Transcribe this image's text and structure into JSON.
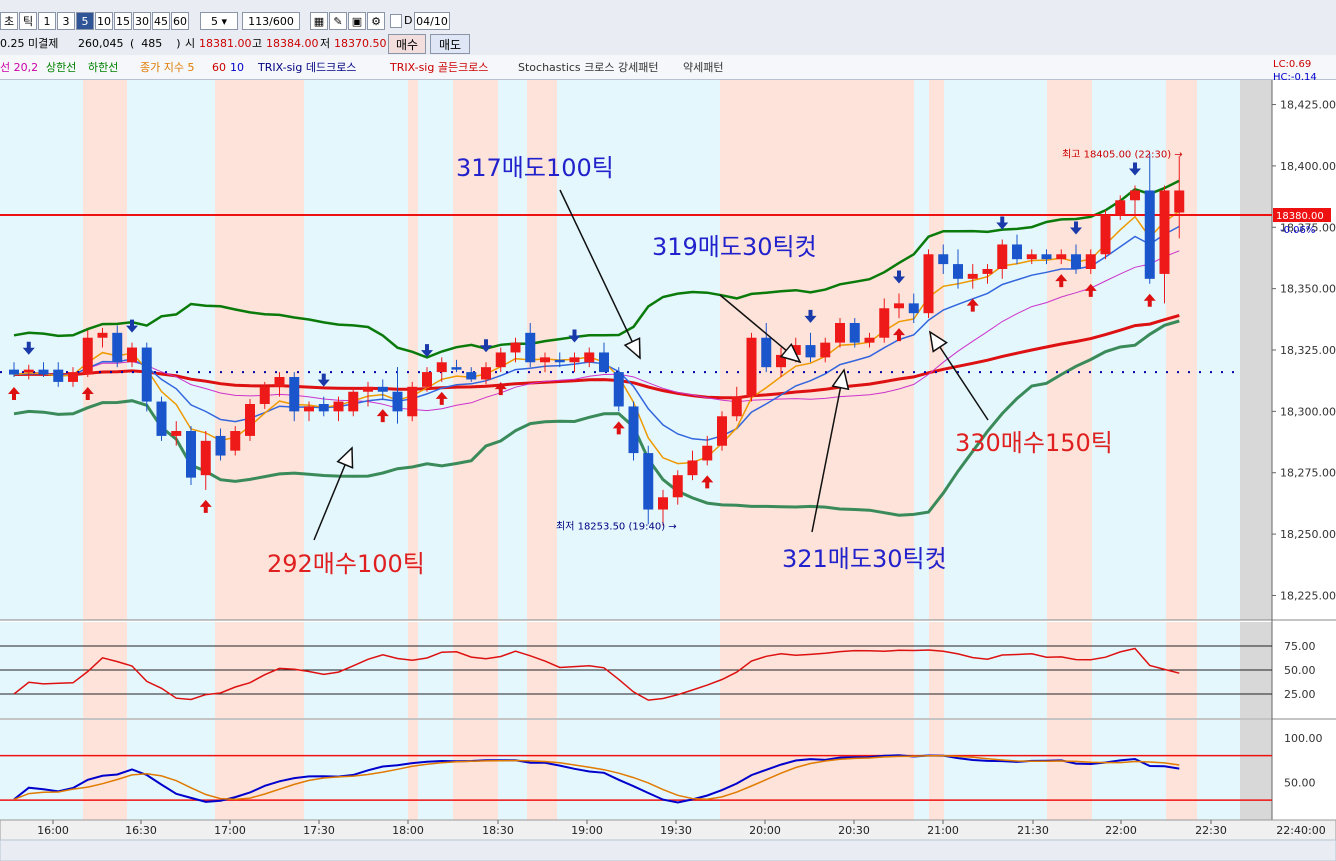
{
  "toolbar": {
    "period_buttons": [
      "초",
      "틱",
      "1",
      "3",
      "5",
      "10",
      "15",
      "30",
      "45",
      "60"
    ],
    "selected_period": "5",
    "period_value": "5",
    "count": "113/600",
    "date": "04/10"
  },
  "quote": {
    "prefix": "0.25",
    "open_interest_label": "미결제",
    "open_interest": "260,045",
    "oi_change": "485",
    "open_label": "시",
    "open": "18381.00",
    "high_label": "고",
    "high": "18384.00",
    "low_label": "저",
    "low": "18370.50",
    "buy_button": "매수",
    "sell_button": "매도"
  },
  "legend": {
    "items": [
      {
        "text": "선 20,2",
        "color": "#cc00aa"
      },
      {
        "text": "상한선",
        "color": "#008000"
      },
      {
        "text": "하한선",
        "color": "#008000"
      },
      {
        "text": "종가 지수 5",
        "color": "#e07b00"
      },
      {
        "text": "60",
        "color": "#cc0000"
      },
      {
        "text": "10",
        "color": "#0000cc"
      },
      {
        "text": "TRIX-sig 데드크로스",
        "color": "#000080"
      },
      {
        "text": "TRIX-sig 골든크로스",
        "color": "#cc0000"
      },
      {
        "text": "Stochastics 크로스 강세패턴",
        "color": "#333333"
      },
      {
        "text": "약세패턴",
        "color": "#333333"
      }
    ],
    "lc": "LC:0.69",
    "hc": "HC:-0.14"
  },
  "chart_data": {
    "type": "candlestick",
    "price_axis": {
      "min": 18215,
      "max": 18435,
      "ticks": [
        18225,
        18250,
        18275,
        18300,
        18325,
        18350,
        18375,
        18400,
        18425
      ]
    },
    "tick_labels": [
      "18,225.00",
      "18,250.00",
      "18,275.00",
      "18,300.00",
      "18,325.00",
      "18,350.00",
      "18,375.00",
      "18,400.00",
      "18,425.00"
    ],
    "time_labels": [
      "16:00",
      "16:30",
      "17:00",
      "17:30",
      "18:00",
      "18:30",
      "19:00",
      "19:30",
      "20:00",
      "20:30",
      "21:00",
      "21:30",
      "22:00",
      "22:30",
      "22:40:00"
    ],
    "current_price": {
      "value": 18380,
      "label": "18380.00",
      "change": "-0.06%"
    },
    "high_note": {
      "text": "최고 18405.00 (22:30) →",
      "value": 18405
    },
    "low_note": {
      "text": "최저 18253.50 (19:40) →",
      "value": 18253.5
    },
    "candles": [
      {
        "o": 18317,
        "h": 18320,
        "l": 18314,
        "c": 18315
      },
      {
        "o": 18316,
        "h": 18319,
        "l": 18313,
        "c": 18317
      },
      {
        "o": 18317,
        "h": 18320,
        "l": 18314,
        "c": 18315
      },
      {
        "o": 18317,
        "h": 18320,
        "l": 18310,
        "c": 18312
      },
      {
        "o": 18312,
        "h": 18318,
        "l": 18310,
        "c": 18316
      },
      {
        "o": 18315,
        "h": 18333,
        "l": 18314,
        "c": 18330
      },
      {
        "o": 18330,
        "h": 18334,
        "l": 18326,
        "c": 18332
      },
      {
        "o": 18332,
        "h": 18335,
        "l": 18318,
        "c": 18320
      },
      {
        "o": 18320,
        "h": 18328,
        "l": 18318,
        "c": 18326
      },
      {
        "o": 18326,
        "h": 18328,
        "l": 18300,
        "c": 18304
      },
      {
        "o": 18304,
        "h": 18306,
        "l": 18288,
        "c": 18290
      },
      {
        "o": 18290,
        "h": 18296,
        "l": 18286,
        "c": 18292
      },
      {
        "o": 18292,
        "h": 18294,
        "l": 18270,
        "c": 18273
      },
      {
        "o": 18274,
        "h": 18292,
        "l": 18268,
        "c": 18288
      },
      {
        "o": 18290,
        "h": 18293,
        "l": 18280,
        "c": 18282
      },
      {
        "o": 18284,
        "h": 18294,
        "l": 18282,
        "c": 18292
      },
      {
        "o": 18290,
        "h": 18305,
        "l": 18288,
        "c": 18303
      },
      {
        "o": 18303,
        "h": 18312,
        "l": 18301,
        "c": 18310
      },
      {
        "o": 18310,
        "h": 18316,
        "l": 18306,
        "c": 18314
      },
      {
        "o": 18314,
        "h": 18316,
        "l": 18296,
        "c": 18300
      },
      {
        "o": 18300,
        "h": 18304,
        "l": 18296,
        "c": 18302
      },
      {
        "o": 18303,
        "h": 18306,
        "l": 18298,
        "c": 18300
      },
      {
        "o": 18300,
        "h": 18306,
        "l": 18296,
        "c": 18304
      },
      {
        "o": 18300,
        "h": 18310,
        "l": 18298,
        "c": 18308
      },
      {
        "o": 18308,
        "h": 18312,
        "l": 18302,
        "c": 18310
      },
      {
        "o": 18310,
        "h": 18313,
        "l": 18305,
        "c": 18308
      },
      {
        "o": 18308,
        "h": 18318,
        "l": 18295,
        "c": 18300
      },
      {
        "o": 18298,
        "h": 18312,
        "l": 18296,
        "c": 18310
      },
      {
        "o": 18310,
        "h": 18318,
        "l": 18308,
        "c": 18316
      },
      {
        "o": 18316,
        "h": 18322,
        "l": 18312,
        "c": 18320
      },
      {
        "o": 18318,
        "h": 18321,
        "l": 18316,
        "c": 18317
      },
      {
        "o": 18316,
        "h": 18318,
        "l": 18312,
        "c": 18313
      },
      {
        "o": 18313,
        "h": 18320,
        "l": 18311,
        "c": 18318
      },
      {
        "o": 18318,
        "h": 18326,
        "l": 18316,
        "c": 18324
      },
      {
        "o": 18324,
        "h": 18330,
        "l": 18320,
        "c": 18328
      },
      {
        "o": 18332,
        "h": 18336,
        "l": 18318,
        "c": 18320
      },
      {
        "o": 18320,
        "h": 18324,
        "l": 18316,
        "c": 18322
      },
      {
        "o": 18321,
        "h": 18324,
        "l": 18318,
        "c": 18320
      },
      {
        "o": 18320,
        "h": 18324,
        "l": 18316,
        "c": 18322
      },
      {
        "o": 18320,
        "h": 18326,
        "l": 18318,
        "c": 18324
      },
      {
        "o": 18324,
        "h": 18328,
        "l": 18318,
        "c": 18316
      },
      {
        "o": 18316,
        "h": 18318,
        "l": 18300,
        "c": 18302
      },
      {
        "o": 18302,
        "h": 18304,
        "l": 18280,
        "c": 18283
      },
      {
        "o": 18283,
        "h": 18286,
        "l": 18254,
        "c": 18260
      },
      {
        "o": 18260,
        "h": 18268,
        "l": 18253.5,
        "c": 18265
      },
      {
        "o": 18265,
        "h": 18276,
        "l": 18262,
        "c": 18274
      },
      {
        "o": 18274,
        "h": 18284,
        "l": 18272,
        "c": 18280
      },
      {
        "o": 18280,
        "h": 18290,
        "l": 18278,
        "c": 18286
      },
      {
        "o": 18286,
        "h": 18300,
        "l": 18284,
        "c": 18298
      },
      {
        "o": 18298,
        "h": 18310,
        "l": 18296,
        "c": 18306
      },
      {
        "o": 18306,
        "h": 18332,
        "l": 18304,
        "c": 18330
      },
      {
        "o": 18330,
        "h": 18336,
        "l": 18316,
        "c": 18318
      },
      {
        "o": 18318,
        "h": 18326,
        "l": 18314,
        "c": 18323
      },
      {
        "o": 18323,
        "h": 18330,
        "l": 18320,
        "c": 18327
      },
      {
        "o": 18327,
        "h": 18332,
        "l": 18320,
        "c": 18322
      },
      {
        "o": 18322,
        "h": 18330,
        "l": 18320,
        "c": 18328
      },
      {
        "o": 18328,
        "h": 18338,
        "l": 18326,
        "c": 18336
      },
      {
        "o": 18336,
        "h": 18338,
        "l": 18326,
        "c": 18328
      },
      {
        "o": 18328,
        "h": 18332,
        "l": 18326,
        "c": 18330
      },
      {
        "o": 18330,
        "h": 18346,
        "l": 18328,
        "c": 18342
      },
      {
        "o": 18342,
        "h": 18348,
        "l": 18338,
        "c": 18344
      },
      {
        "o": 18344,
        "h": 18348,
        "l": 18336,
        "c": 18340
      },
      {
        "o": 18340,
        "h": 18366,
        "l": 18338,
        "c": 18364
      },
      {
        "o": 18364,
        "h": 18368,
        "l": 18356,
        "c": 18360
      },
      {
        "o": 18360,
        "h": 18366,
        "l": 18350,
        "c": 18354
      },
      {
        "o": 18354,
        "h": 18360,
        "l": 18350,
        "c": 18356
      },
      {
        "o": 18356,
        "h": 18360,
        "l": 18352,
        "c": 18358
      },
      {
        "o": 18358,
        "h": 18370,
        "l": 18354,
        "c": 18368
      },
      {
        "o": 18368,
        "h": 18372,
        "l": 18360,
        "c": 18362
      },
      {
        "o": 18362,
        "h": 18366,
        "l": 18360,
        "c": 18364
      },
      {
        "o": 18364,
        "h": 18366,
        "l": 18360,
        "c": 18362
      },
      {
        "o": 18362,
        "h": 18366,
        "l": 18360,
        "c": 18364
      },
      {
        "o": 18364,
        "h": 18368,
        "l": 18356,
        "c": 18358
      },
      {
        "o": 18358,
        "h": 18366,
        "l": 18356,
        "c": 18364
      },
      {
        "o": 18364,
        "h": 18382,
        "l": 18362,
        "c": 18380
      },
      {
        "o": 18380,
        "h": 18388,
        "l": 18378,
        "c": 18386
      },
      {
        "o": 18386,
        "h": 18392,
        "l": 18380,
        "c": 18390
      },
      {
        "o": 18390,
        "h": 18405,
        "l": 18352,
        "c": 18354
      },
      {
        "o": 18356,
        "h": 18392,
        "l": 18344,
        "c": 18390
      },
      {
        "o": 18381,
        "h": 18404,
        "l": 18370.5,
        "c": 18390
      }
    ],
    "annotations": [
      {
        "text": "317매도100틱",
        "color": "#2222cc"
      },
      {
        "text": "319매도30틱컷",
        "color": "#2222cc"
      },
      {
        "text": "330매수150틱",
        "color": "#e02020"
      },
      {
        "text": "292매수100틱",
        "color": "#e02020"
      },
      {
        "text": "321매도30틱컷",
        "color": "#2222cc"
      }
    ],
    "stoch_ticks": [
      "75.00",
      "50.00",
      "25.00"
    ],
    "trix_ticks": [
      "100.00",
      "50.00"
    ]
  }
}
